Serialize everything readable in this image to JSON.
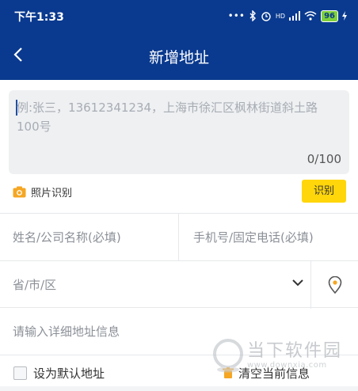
{
  "status_bar": {
    "time": "下午1:33",
    "signal_text": "•••",
    "network": "HD",
    "battery": "96"
  },
  "nav": {
    "title": "新增地址"
  },
  "address_input": {
    "placeholder": "例:张三，13612341234，上海市徐汇区枫林街道斜土路100号",
    "counter": "0/100"
  },
  "photo_recognition": {
    "label": "照片识别",
    "button": "识别"
  },
  "form": {
    "name_placeholder": "姓名/公司名称(必填)",
    "phone_placeholder": "手机号/固定电话(必填)",
    "region_placeholder": "省/市/区",
    "detail_placeholder": "请输入详细地址信息"
  },
  "footer": {
    "default_label": "设为默认地址",
    "clear_label": "清空当前信息"
  },
  "watermark": {
    "title": "当下软件园",
    "url": "www.downxia.com"
  },
  "colors": {
    "header": "#0a3a8f",
    "accent": "#ffd60a",
    "camera": "#f5a623"
  }
}
